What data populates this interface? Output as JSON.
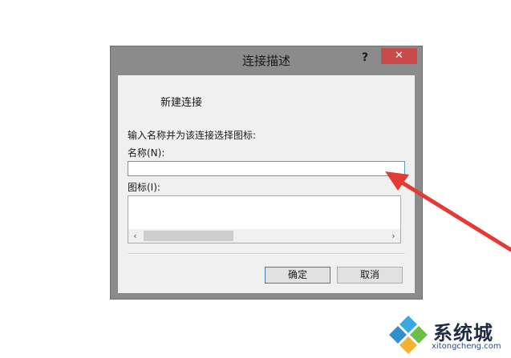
{
  "dialog": {
    "title": "连接描述",
    "help_label": "?",
    "close_label": "✕",
    "heading": "新建连接",
    "instruction": "输入名称并为该连接选择图标:",
    "name_label": "名称(N):",
    "name_value": "",
    "icon_label": "图标(I):",
    "scroll_left": "‹",
    "scroll_right": "›",
    "ok_label": "确定",
    "cancel_label": "取消"
  },
  "annotation": {
    "arrow_color": "#e53935"
  },
  "watermark": {
    "title": "系统城",
    "subtitle": "xitongcheng.com",
    "icon": "diamond-logo-icon"
  }
}
